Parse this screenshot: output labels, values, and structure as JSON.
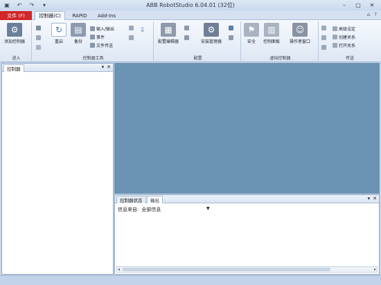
{
  "window": {
    "title": "ABB RobotStudio 6.04.01 (32位)",
    "quick_access": [
      "save-icon",
      "undo-icon",
      "redo-icon",
      "customize-icon"
    ]
  },
  "tabs": {
    "file": "文件 (F)",
    "items": [
      {
        "label": "控制器(C)",
        "active": true
      },
      {
        "label": "RAPID",
        "active": false
      },
      {
        "label": "Add-Ins",
        "active": false
      }
    ]
  },
  "ribbon": {
    "groups": {
      "enter": {
        "label": "进入",
        "add_controller": "添加控制器"
      },
      "tools": {
        "label": "控制器工具",
        "restart": "重启",
        "backup": "备份",
        "io": "输入/输出",
        "events": "事件",
        "file_transfer": "文件传送"
      },
      "config": {
        "label": "配置",
        "config_editor": "配置编辑器",
        "safety_manager": "安装管理器"
      },
      "virtual": {
        "label": "虚拟控制器",
        "safety": "安全",
        "control_panel": "控制面板",
        "operator_window": "操作者窗口"
      },
      "transfer": {
        "label": "传送",
        "create_relation": "创建关系",
        "open_relation": "打开关系",
        "advanced": "高级设定"
      }
    }
  },
  "left_panel": {
    "tab_label": "控制器"
  },
  "output_panel": {
    "tabs": [
      {
        "label": "控制器状态",
        "active": false
      },
      {
        "label": "输出",
        "active": true
      }
    ],
    "filter_label": "信息来自:",
    "filter_value": "全部信息"
  },
  "colors": {
    "file_tab": "#d1262a",
    "document_area": "#6b93b3",
    "ribbon_bg": "#f6f9fd"
  }
}
